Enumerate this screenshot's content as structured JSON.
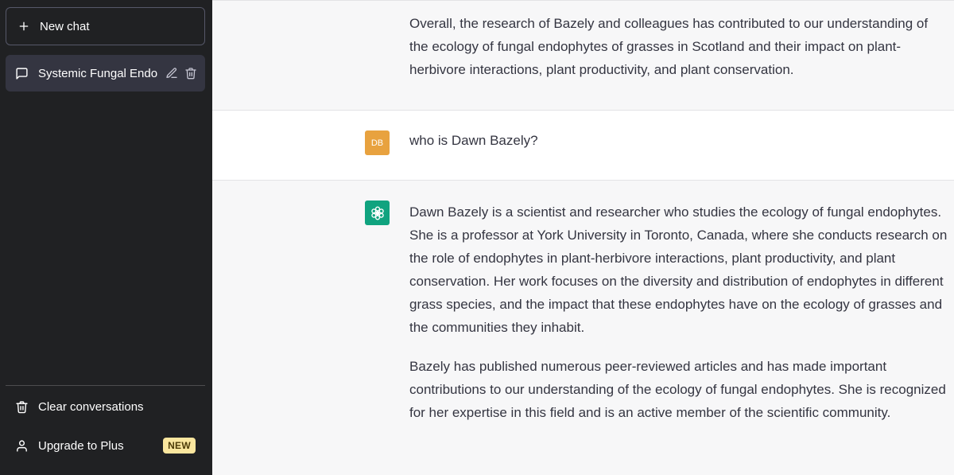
{
  "sidebar": {
    "new_chat_label": "New chat",
    "conversations": [
      {
        "label": "Systemic Fungal Endo"
      }
    ],
    "clear_label": "Clear conversations",
    "upgrade_label": "Upgrade to Plus",
    "new_badge": "NEW"
  },
  "messages": {
    "ai_prev": {
      "paragraphs": [
        "Overall, the research of Bazely and colleagues has contributed to our understanding of the ecology of fungal endophytes of grasses in Scotland and their impact on plant-herbivore interactions, plant productivity, and plant conservation."
      ]
    },
    "user": {
      "avatar_initials": "DB",
      "text": "who is Dawn Bazely?"
    },
    "ai": {
      "paragraphs": [
        "Dawn Bazely is a scientist and researcher who studies the ecology of fungal endophytes. She is a professor at York University in Toronto, Canada, where she conducts research on the role of endophytes in plant-herbivore interactions, plant productivity, and plant conservation. Her work focuses on the diversity and distribution of endophytes in different grass species, and the impact that these endophytes have on the ecology of grasses and the communities they inhabit.",
        "Bazely has published numerous peer-reviewed articles and has made important contributions to our understanding of the ecology of fungal endophytes. She is recognized for her expertise in this field and is an active member of the scientific community."
      ]
    }
  },
  "icons": {
    "new_chat": "plus-icon",
    "conversation": "chat-bubble-icon",
    "edit": "pencil-icon",
    "delete": "trash-icon",
    "clear": "trash-icon",
    "upgrade": "user-icon",
    "assistant": "openai-logo-icon"
  },
  "colors": {
    "sidebar_bg": "#202123",
    "active_item_bg": "#343541",
    "ai_message_bg": "#f7f7f8",
    "user_avatar": "#e8a23f",
    "assistant_avatar": "#10a37f",
    "badge_bg": "#fae69e"
  }
}
